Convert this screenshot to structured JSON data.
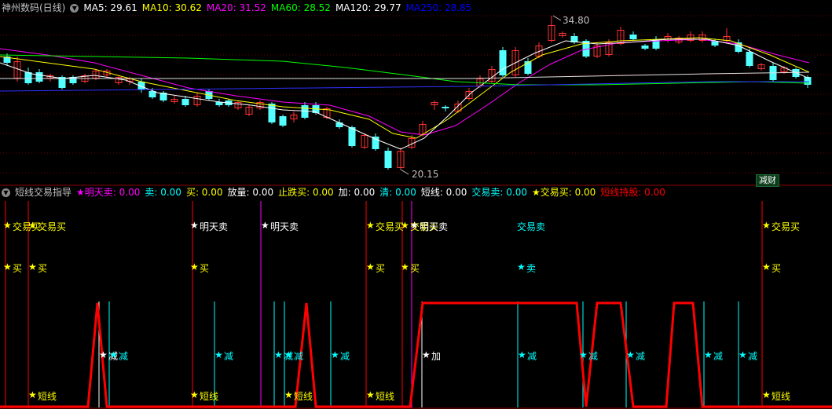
{
  "header": {
    "stock_name": "神州数码(日线)",
    "ma": [
      {
        "label": "MA5: 29.61",
        "color": "#ffffff"
      },
      {
        "label": "MA10: 30.62",
        "color": "#ffff00"
      },
      {
        "label": "MA20: 31.52",
        "color": "#ff00ff"
      },
      {
        "label": "MA60: 28.52",
        "color": "#00ff00"
      },
      {
        "label": "MA120: 29.77",
        "color": "#ffffff"
      },
      {
        "label": "MA250: 28.85",
        "color": "#0000ff"
      }
    ]
  },
  "main_chart": {
    "high_label": "34.80",
    "low_label": "20.15",
    "badge": "减财"
  },
  "indicator": {
    "name": "短线交易指导",
    "values": [
      {
        "label": "★明天卖: 0.00",
        "color": "#ff00ff"
      },
      {
        "label": "卖: 0.00",
        "color": "#00ffff"
      },
      {
        "label": "买: 0.00",
        "color": "#ffff00"
      },
      {
        "label": "放量: 0.00",
        "color": "#ffffff"
      },
      {
        "label": "止跌买: 0.00",
        "color": "#ffff00"
      },
      {
        "label": "加: 0.00",
        "color": "#ffffff"
      },
      {
        "label": "清: 0.00",
        "color": "#00ffff"
      },
      {
        "label": "短线: 0.00",
        "color": "#ffffff"
      },
      {
        "label": "交易卖: 0.00",
        "color": "#00ffff"
      },
      {
        "label": "★交易买: 0.00",
        "color": "#ffff00"
      },
      {
        "label": "短线持股: 0.00",
        "color": "#ff0000"
      }
    ],
    "signal_words": {
      "trade_buy": "交易买",
      "buy": "买",
      "tomorrow_sell": "明天卖",
      "trade_sell": "交易卖",
      "sell": "卖",
      "reduce": "减",
      "add": "加",
      "short": "短线",
      "star": "★"
    }
  },
  "colors": {
    "up": "#ff3232",
    "down": "#54ffff",
    "ma5": "#ffffff",
    "ma10": "#ffff00",
    "ma20": "#ff00ff",
    "ma60": "#00ff00",
    "ma120": "#e0e0e0",
    "ma250": "#3030ff",
    "grid": "#700000",
    "hold_line": "#ff0000"
  }
}
